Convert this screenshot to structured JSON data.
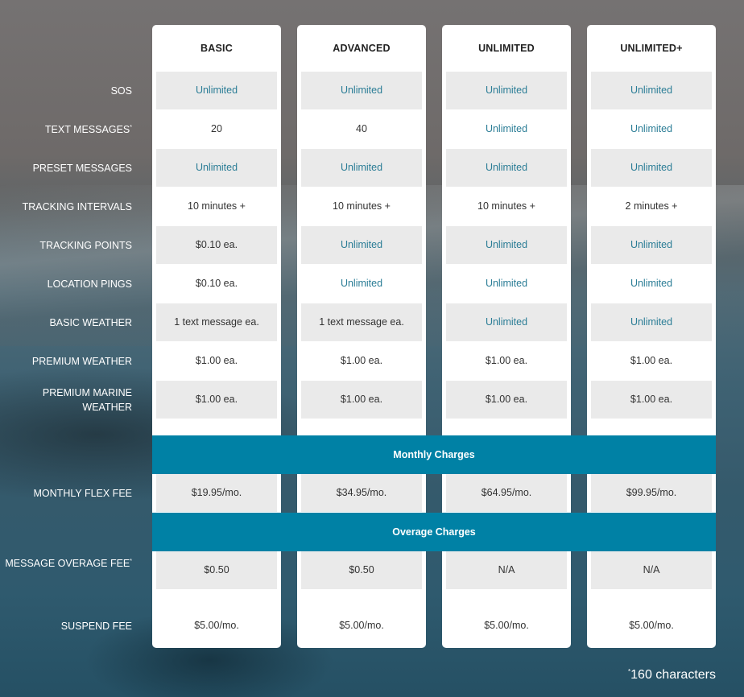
{
  "plans": [
    {
      "name": "BASIC",
      "features": [
        "Unlimited",
        "20",
        "Unlimited",
        "10 minutes +",
        "$0.10 ea.",
        "$0.10 ea.",
        "1 text message ea.",
        "$1.00 ea.",
        "$1.00 ea."
      ],
      "monthly": [
        "$19.95/mo."
      ],
      "overage": [
        "$0.50",
        "$5.00/mo."
      ]
    },
    {
      "name": "ADVANCED",
      "features": [
        "Unlimited",
        "40",
        "Unlimited",
        "10 minutes +",
        "Unlimited",
        "Unlimited",
        "1 text message ea.",
        "$1.00 ea.",
        "$1.00 ea."
      ],
      "monthly": [
        "$34.95/mo."
      ],
      "overage": [
        "$0.50",
        "$5.00/mo."
      ]
    },
    {
      "name": "UNLIMITED",
      "features": [
        "Unlimited",
        "Unlimited",
        "Unlimited",
        "10 minutes +",
        "Unlimited",
        "Unlimited",
        "Unlimited",
        "$1.00 ea.",
        "$1.00 ea."
      ],
      "monthly": [
        "$64.95/mo."
      ],
      "overage": [
        "N/A",
        "$5.00/mo."
      ]
    },
    {
      "name": "UNLIMITED+",
      "features": [
        "Unlimited",
        "Unlimited",
        "Unlimited",
        "2 minutes +",
        "Unlimited",
        "Unlimited",
        "Unlimited",
        "$1.00 ea.",
        "$1.00 ea."
      ],
      "monthly": [
        "$99.95/mo."
      ],
      "overage": [
        "N/A",
        "$5.00/mo."
      ]
    }
  ],
  "feature_labels": [
    {
      "text": "SOS",
      "mark": ""
    },
    {
      "text": "TEXT MESSAGES",
      "mark": "*"
    },
    {
      "text": "PRESET MESSAGES",
      "mark": ""
    },
    {
      "text": "TRACKING INTERVALS",
      "mark": ""
    },
    {
      "text": "TRACKING POINTS",
      "mark": ""
    },
    {
      "text": "LOCATION PINGS",
      "mark": ""
    },
    {
      "text": "BASIC WEATHER",
      "mark": ""
    },
    {
      "text": "PREMIUM WEATHER",
      "mark": ""
    },
    {
      "text": "PREMIUM MARINE WEATHER",
      "mark": ""
    }
  ],
  "monthly_labels": [
    {
      "text": "MONTHLY FLEX FEE",
      "mark": ""
    }
  ],
  "overage_labels": [
    {
      "text": "MESSAGE OVERAGE FEE",
      "mark": "*"
    },
    {
      "text": "SUSPEND FEE",
      "mark": ""
    }
  ],
  "sections": {
    "monthly_title": "Monthly Charges",
    "overage_title": "Overage Charges"
  },
  "footnote": {
    "mark": "*",
    "text": "160 characters"
  },
  "colors": {
    "accent_text": "#2b7d96",
    "banner": "#0081a5",
    "cell_gray": "#eaeaea"
  }
}
